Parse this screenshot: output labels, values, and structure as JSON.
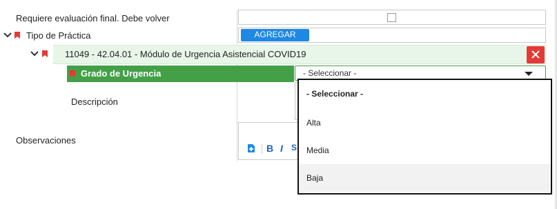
{
  "form": {
    "evaluacion_label": "Requiere evaluación final. Debe volver",
    "tipo_practica_label": "Tipo de Práctica",
    "agregar_label": "AGREGAR",
    "practica_item": "11049 - 42.04.01 - Módulo de Urgencia Asistencial COVID19",
    "grado_label": "Grado de Urgencia",
    "descripcion_label": "Descripción",
    "observaciones_label": "Observaciones"
  },
  "grado_select": {
    "selected": "- Seleccionar -",
    "options": [
      "- Seleccionar -",
      "Alta",
      "Media",
      "Baja"
    ],
    "hovered_option": "Baja"
  },
  "colors": {
    "accent_blue": "#1e88e5",
    "green": "#43a047",
    "light_green": "#e8f5e9",
    "red": "#e53935",
    "bookmark_red": "#e53935"
  },
  "icons": {
    "expand": "chevron-down-icon",
    "bookmark": "bookmark-icon",
    "close": "close-icon",
    "dropdown": "caret-down-icon",
    "editor": [
      "add-document-icon",
      "bold-icon",
      "italic-icon"
    ]
  }
}
